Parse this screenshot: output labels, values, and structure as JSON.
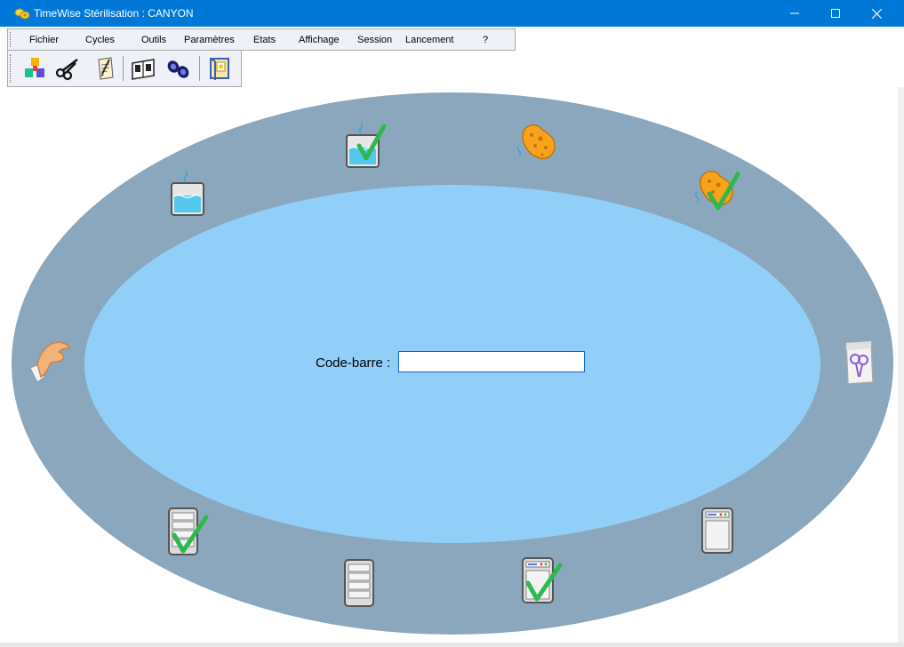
{
  "window": {
    "title": "TimeWise Stérilisation : CANYON",
    "accent": "#0078d7"
  },
  "menu": {
    "items": [
      {
        "label": "Fichier"
      },
      {
        "label": "Cycles"
      },
      {
        "label": "Outils"
      },
      {
        "label": "Paramètres"
      },
      {
        "label": "Etats"
      },
      {
        "label": "Affichage"
      },
      {
        "label": "Session"
      },
      {
        "label": "Lancement"
      },
      {
        "label": "?"
      }
    ]
  },
  "toolbar": {
    "buttons": [
      {
        "icon": "color-blocks-icon"
      },
      {
        "icon": "scissors-icon"
      },
      {
        "icon": "document-pen-icon"
      },
      {
        "icon": "tools-book-icon"
      },
      {
        "icon": "binoculars-icon"
      },
      {
        "icon": "exit-door-icon"
      }
    ]
  },
  "workflow": {
    "outer_color": "#8ba7bd",
    "inner_color": "#91cef8",
    "stations": [
      {
        "icon": "hand-icon",
        "checked": false
      },
      {
        "icon": "soak-tank-icon",
        "checked": false
      },
      {
        "icon": "soak-tank-icon",
        "checked": true
      },
      {
        "icon": "sponge-icon",
        "checked": false
      },
      {
        "icon": "sponge-icon",
        "checked": true
      },
      {
        "icon": "sterile-pouch-icon",
        "checked": false
      },
      {
        "icon": "autoclave-icon",
        "checked": false
      },
      {
        "icon": "autoclave-icon",
        "checked": true
      },
      {
        "icon": "rack-cabinet-icon",
        "checked": false
      },
      {
        "icon": "rack-cabinet-icon",
        "checked": true
      }
    ]
  },
  "barcode": {
    "label": "Code-barre :",
    "value": ""
  }
}
